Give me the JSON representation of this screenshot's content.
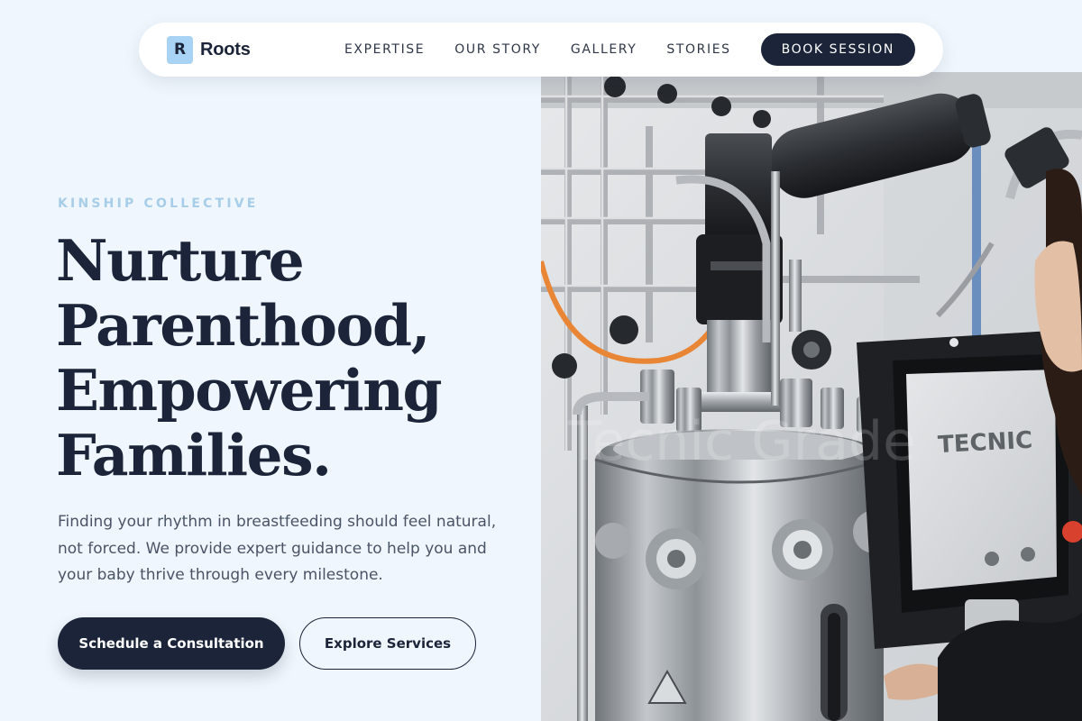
{
  "nav": {
    "logo_letter": "R",
    "brand": "Roots",
    "links": [
      "EXPERTISE",
      "OUR STORY",
      "GALLERY",
      "STORIES"
    ],
    "cta": "BOOK SESSION"
  },
  "hero": {
    "eyebrow": "KINSHIP COLLECTIVE",
    "headline": [
      "Nurture",
      "Parenthood,",
      "Empowering",
      "Families."
    ],
    "lede": "Finding your rhythm in breastfeeding should feel natural, not forced. We provide expert guidance to help you and your baby thrive through every milestone.",
    "primary_cta": "Schedule a Consultation",
    "secondary_cta": "Explore Services"
  },
  "image": {
    "screen_brand": "TECNIC"
  },
  "colors": {
    "page_bg": "#eff6fd",
    "navy": "#1b2438",
    "accent_light_blue": "#a9d3f5",
    "eyebrow": "#a8cde9",
    "body_text": "#4b5466"
  }
}
